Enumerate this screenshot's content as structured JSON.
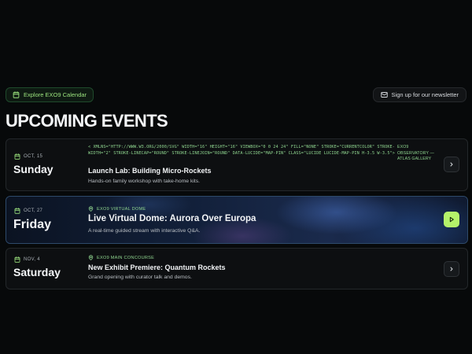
{
  "header": {
    "calendar_button": "Explore EXO9 Calendar",
    "newsletter_button": "Sign up for our newsletter",
    "title": "UPCOMING EVENTS"
  },
  "events": [
    {
      "date": "OCT, 15",
      "day": "Sunday",
      "location_raw": "< xmlns=\"http://www.w3.org/2000/svg\" width=\"16\" height=\"16\" viewBox=\"0 0 24 24\" fill=\"none\" stroke=\"currentColor\" stroke-width=\"2\" stroke-linecap=\"round\" stroke-linejoin=\"round\" data-lucide=\"map-pin\" class=\"lucide lucide-map-pin h-3.5 w-3.5\">",
      "location": "EXO9 OBSERVATORY — ATLAS GALLERY",
      "title": "Launch Lab: Building Micro-Rockets",
      "description": "Hands-on family workshop with take-home kits."
    },
    {
      "date": "OCT, 27",
      "day": "Friday",
      "location": "EXO9 VIRTUAL DOME",
      "title": "Live Virtual Dome: Aurora Over Europa",
      "description": "A real-time guided stream with interactive Q&A."
    },
    {
      "date": "NOV, 4",
      "day": "Saturday",
      "location": "EXO9 MAIN CONCOURSE",
      "title": "New Exhibit Premiere: Quantum Rockets",
      "description": "Grand opening with curator talk and demos."
    }
  ],
  "colors": {
    "accent": "#b4f26a",
    "location_text": "#8fd58f",
    "background": "#07090a"
  },
  "icons": {
    "calendar": "calendar-icon",
    "mail": "mail-icon",
    "map_pin": "map-pin-icon",
    "chevron": "chevron-right-icon",
    "play": "play-icon"
  }
}
